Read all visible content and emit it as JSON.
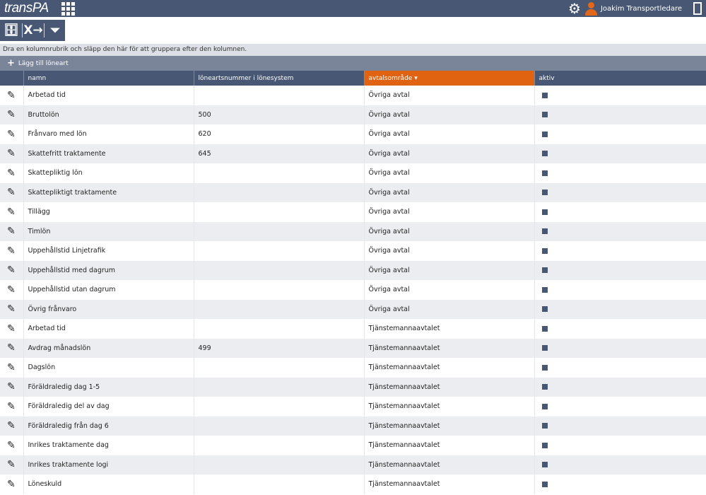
{
  "header": {
    "logo": "transPA",
    "user_name": "Joakim Transportledare",
    "icons": [
      "apps-grid-icon",
      "gear-icon",
      "user-icon",
      "logout-icon"
    ]
  },
  "toolbar": {
    "icons": [
      "archive-icon",
      "excel-export-icon",
      "filter-icon"
    ]
  },
  "group_hint": "Dra en kolumnrubrik och släpp den här för att gruppera efter den kolumnen.",
  "add_label": "Lägg till löneart",
  "columns": [
    "namn",
    "löneartsnummer i lönesystem",
    "avtalsområde",
    "aktiv"
  ],
  "sorted_column": "avtalsområde",
  "accent": "#e06312",
  "rows": [
    {
      "namn": "Arbetad tid",
      "nr": "",
      "avtal": "Övriga avtal"
    },
    {
      "namn": "Bruttolön",
      "nr": "500",
      "avtal": "Övriga avtal"
    },
    {
      "namn": "Frånvaro med lön",
      "nr": "620",
      "avtal": "Övriga avtal"
    },
    {
      "namn": "Skattefritt traktamente",
      "nr": "645",
      "avtal": "Övriga avtal"
    },
    {
      "namn": "Skattepliktig lön",
      "nr": "",
      "avtal": "Övriga avtal"
    },
    {
      "namn": "Skattepliktigt traktamente",
      "nr": "",
      "avtal": "Övriga avtal"
    },
    {
      "namn": "Tillägg",
      "nr": "",
      "avtal": "Övriga avtal"
    },
    {
      "namn": "Timlön",
      "nr": "",
      "avtal": "Övriga avtal"
    },
    {
      "namn": "Uppehållstid Linjetrafik",
      "nr": "",
      "avtal": "Övriga avtal"
    },
    {
      "namn": "Uppehållstid med dagrum",
      "nr": "",
      "avtal": "Övriga avtal"
    },
    {
      "namn": "Uppehållstid utan dagrum",
      "nr": "",
      "avtal": "Övriga avtal"
    },
    {
      "namn": "Övrig frånvaro",
      "nr": "",
      "avtal": "Övriga avtal"
    },
    {
      "namn": "Arbetad tid",
      "nr": "",
      "avtal": "Tjänstemannaavtalet"
    },
    {
      "namn": "Avdrag månadslön",
      "nr": "499",
      "avtal": "Tjänstemannaavtalet"
    },
    {
      "namn": "Dagslön",
      "nr": "",
      "avtal": "Tjänstemannaavtalet"
    },
    {
      "namn": "Föräldraledig dag 1-5",
      "nr": "",
      "avtal": "Tjänstemannaavtalet"
    },
    {
      "namn": "Föräldraledig del av dag",
      "nr": "",
      "avtal": "Tjänstemannaavtalet"
    },
    {
      "namn": "Föräldraledig från dag 6",
      "nr": "",
      "avtal": "Tjänstemannaavtalet"
    },
    {
      "namn": "Inrikes traktamente dag",
      "nr": "",
      "avtal": "Tjänstemannaavtalet"
    },
    {
      "namn": "Inrikes traktamente logi",
      "nr": "",
      "avtal": "Tjänstemannaavtalet"
    },
    {
      "namn": "Löneskuld",
      "nr": "",
      "avtal": "Tjänstemannaavtalet"
    }
  ]
}
